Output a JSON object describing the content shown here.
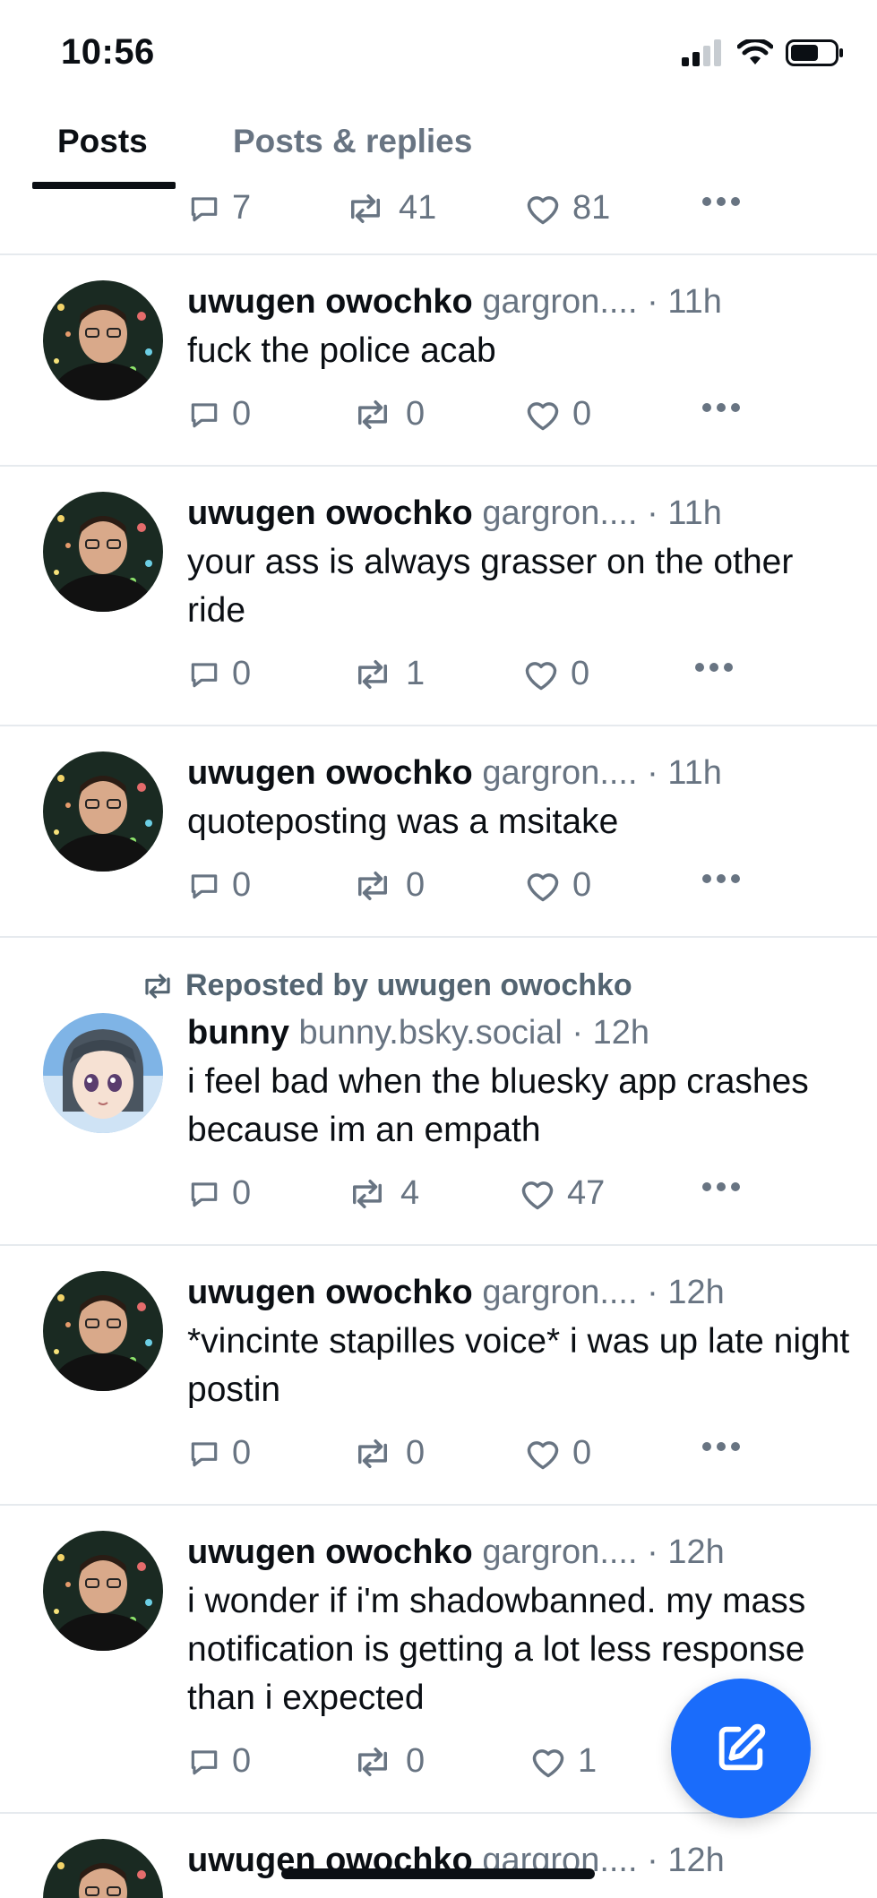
{
  "status_bar": {
    "time": "10:56",
    "icons": [
      "signal-icon",
      "wifi-icon",
      "battery-icon"
    ]
  },
  "tabs": [
    {
      "label": "Posts",
      "active": true
    },
    {
      "label": "Posts & replies",
      "active": false
    }
  ],
  "colors": {
    "text_primary": "#0b0f14",
    "text_secondary": "#687482",
    "divider": "#e6eaee",
    "accent": "#1a6cfb"
  },
  "top_actions": {
    "replies": "7",
    "reposts": "41",
    "likes": "81"
  },
  "posts": [
    {
      "author": "uwugen owochko",
      "handle": "gargron....",
      "dot": "·",
      "time": "11h",
      "text": "fuck the police acab",
      "replies": "0",
      "reposts": "0",
      "likes": "0"
    },
    {
      "author": "uwugen owochko",
      "handle": "gargron....",
      "dot": "·",
      "time": "11h",
      "text": "your ass is always grasser on the other ride",
      "replies": "0",
      "reposts": "1",
      "likes": "0"
    },
    {
      "author": "uwugen owochko",
      "handle": "gargron....",
      "dot": "·",
      "time": "11h",
      "text": "quoteposting was a msitake",
      "replies": "0",
      "reposts": "0",
      "likes": "0"
    },
    {
      "repost_label": "Reposted by uwugen owochko",
      "author": "bunny",
      "handle": "bunny.bsky.social",
      "dot": "·",
      "time": "12h",
      "text": "i feel bad when the bluesky app crashes because im an empath",
      "replies": "0",
      "reposts": "4",
      "likes": "47"
    },
    {
      "author": "uwugen owochko",
      "handle": "gargron....",
      "dot": "·",
      "time": "12h",
      "text": "*vincinte stapilles voice* i was up late night postin",
      "replies": "0",
      "reposts": "0",
      "likes": "0"
    },
    {
      "author": "uwugen owochko",
      "handle": "gargron....",
      "dot": "·",
      "time": "12h",
      "text": "i wonder if i'm shadowbanned. my mass notification is getting a lot less response than i expected",
      "replies": "0",
      "reposts": "0",
      "likes": "1"
    },
    {
      "author": "uwugen owochko",
      "handle": "gargron....",
      "dot": "·",
      "time": "12h"
    }
  ],
  "fab": {
    "icon": "compose-icon"
  }
}
